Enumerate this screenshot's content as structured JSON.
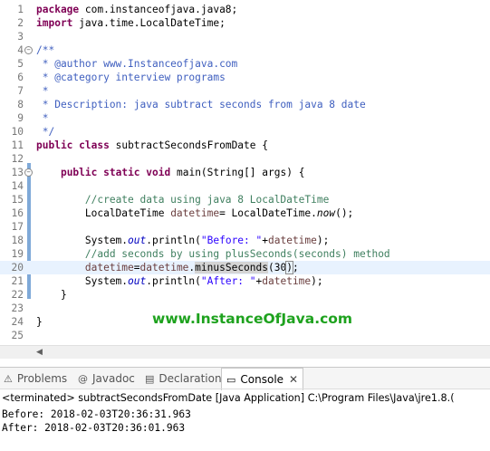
{
  "editor": {
    "lines": [
      {
        "n": "1",
        "segs": [
          {
            "t": "package",
            "c": "kw"
          },
          {
            "t": " com.instanceofjava.java8;"
          }
        ]
      },
      {
        "n": "2",
        "segs": [
          {
            "t": "import",
            "c": "kw"
          },
          {
            "t": " java.time.LocalDateTime;"
          }
        ]
      },
      {
        "n": "3",
        "segs": []
      },
      {
        "n": "4",
        "fold": "−",
        "segs": [
          {
            "t": "/**",
            "c": "jd"
          }
        ]
      },
      {
        "n": "5",
        "segs": [
          {
            "t": " * @author www.Instanceofjava.com",
            "c": "jd"
          }
        ]
      },
      {
        "n": "6",
        "segs": [
          {
            "t": " * @category interview programs",
            "c": "jd"
          }
        ]
      },
      {
        "n": "7",
        "segs": [
          {
            "t": " *",
            "c": "jd"
          }
        ]
      },
      {
        "n": "8",
        "segs": [
          {
            "t": " * Description: java subtract seconds from java 8 date",
            "c": "jd"
          }
        ]
      },
      {
        "n": "9",
        "segs": [
          {
            "t": " *",
            "c": "jd"
          }
        ]
      },
      {
        "n": "10",
        "segs": [
          {
            "t": " */",
            "c": "jd"
          }
        ]
      },
      {
        "n": "11",
        "segs": [
          {
            "t": "public",
            "c": "kw"
          },
          {
            "t": " "
          },
          {
            "t": "class",
            "c": "kw"
          },
          {
            "t": " subtractSecondsFromDate {"
          }
        ]
      },
      {
        "n": "12",
        "segs": []
      },
      {
        "n": "13",
        "fold": "−",
        "segs": [
          {
            "t": "    "
          },
          {
            "t": "public",
            "c": "kw"
          },
          {
            "t": " "
          },
          {
            "t": "static",
            "c": "kw"
          },
          {
            "t": " "
          },
          {
            "t": "void",
            "c": "kw"
          },
          {
            "t": " main(String[] args) {"
          }
        ]
      },
      {
        "n": "14",
        "segs": []
      },
      {
        "n": "15",
        "segs": [
          {
            "t": "        "
          },
          {
            "t": "//create data using java 8 LocalDateTime",
            "c": "cm"
          }
        ]
      },
      {
        "n": "16",
        "segs": [
          {
            "t": "        LocalDateTime "
          },
          {
            "t": "datetime",
            "c": "var"
          },
          {
            "t": "= LocalDateTime."
          },
          {
            "t": "now",
            "c": "stc"
          },
          {
            "t": "();"
          }
        ]
      },
      {
        "n": "17",
        "segs": []
      },
      {
        "n": "18",
        "segs": [
          {
            "t": "        System."
          },
          {
            "t": "out",
            "c": "fld"
          },
          {
            "t": ".println("
          },
          {
            "t": "\"Before: \"",
            "c": "str"
          },
          {
            "t": "+"
          },
          {
            "t": "datetime",
            "c": "var"
          },
          {
            "t": ");"
          }
        ]
      },
      {
        "n": "19",
        "segs": [
          {
            "t": "        "
          },
          {
            "t": "//add seconds by using plusSeconds(seconds) method",
            "c": "cm"
          }
        ]
      },
      {
        "n": "20",
        "hl": true,
        "segs": [
          {
            "t": "        "
          },
          {
            "t": "datetime",
            "c": "var"
          },
          {
            "t": "="
          },
          {
            "t": "datetime",
            "c": "var"
          },
          {
            "t": "."
          },
          {
            "t": "minusSeconds",
            "c": "mocc"
          },
          {
            "t": "(30"
          },
          {
            "t": ")",
            "c": "brk"
          },
          {
            "t": ";"
          }
        ]
      },
      {
        "n": "21",
        "segs": [
          {
            "t": "        System."
          },
          {
            "t": "out",
            "c": "fld"
          },
          {
            "t": ".println("
          },
          {
            "t": "\"After: \"",
            "c": "str"
          },
          {
            "t": "+"
          },
          {
            "t": "datetime",
            "c": "var"
          },
          {
            "t": ");"
          }
        ]
      },
      {
        "n": "22",
        "segs": [
          {
            "t": "    }"
          }
        ]
      },
      {
        "n": "23",
        "segs": []
      },
      {
        "n": "24",
        "segs": [
          {
            "t": "}"
          }
        ]
      },
      {
        "n": "25",
        "segs": []
      }
    ],
    "watermark": "www.InstanceOfJava.com"
  },
  "views": {
    "tabs": [
      {
        "label": "Problems",
        "icon": "problems-icon",
        "glyph": "⚠"
      },
      {
        "label": "Javadoc",
        "icon": "javadoc-icon",
        "glyph": "@"
      },
      {
        "label": "Declaration",
        "icon": "declaration-icon",
        "glyph": "▤"
      },
      {
        "label": "Console",
        "icon": "console-icon",
        "glyph": "▭",
        "active": true
      }
    ],
    "close_glyph": "✕"
  },
  "console": {
    "status": "<terminated> subtractSecondsFromDate [Java Application] C:\\Program Files\\Java\\jre1.8.(",
    "output": [
      "Before: 2018-02-03T20:36:31.963",
      "After: 2018-02-03T20:36:01.963"
    ]
  },
  "colors": {
    "keyword": "#7f0055",
    "javadoc": "#3f5fbf",
    "comment": "#3f7f5f",
    "string": "#2a00ff",
    "field": "#0000c0",
    "variable": "#6a3e3e",
    "highlight": "#e8f2fe",
    "watermark": "#1ea21e"
  }
}
